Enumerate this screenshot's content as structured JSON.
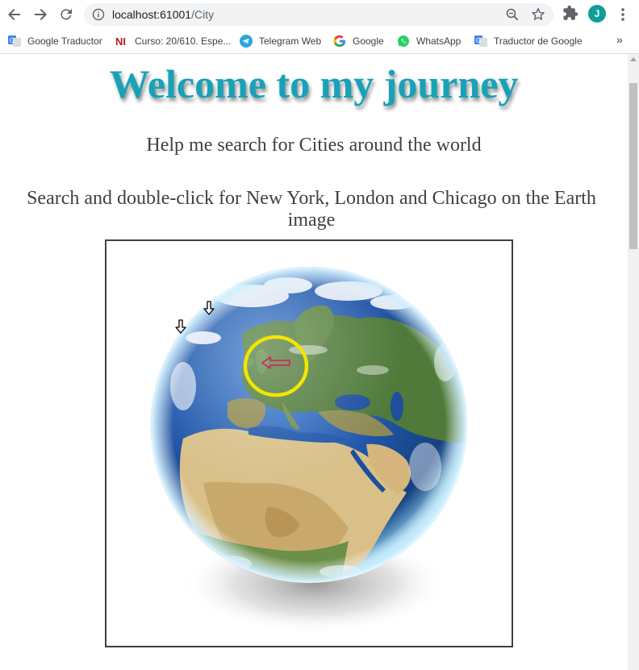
{
  "browser": {
    "url_host": "localhost:61001",
    "url_path": "/City",
    "profile_initial": "J",
    "bookmarks": [
      {
        "label": "Google Traductor",
        "icon": "google-translate-icon"
      },
      {
        "label": "Curso: 20/610. Espe...",
        "icon": "ni-logo-icon"
      },
      {
        "label": "Telegram Web",
        "icon": "telegram-icon"
      },
      {
        "label": "Google",
        "icon": "google-icon"
      },
      {
        "label": "WhatsApp",
        "icon": "whatsapp-icon"
      },
      {
        "label": "Traductor de Google",
        "icon": "google-translate-icon"
      }
    ],
    "overflow": "»"
  },
  "page": {
    "title": "Welcome to my journey",
    "subtitle": "Help me search for Cities around the world",
    "instruction": "Search and double-click for New York, London and Chicago on the Earth image"
  },
  "colors": {
    "title": "#17a2b8",
    "highlight_circle": "#f2e600",
    "target_arrow": "#d81b60"
  }
}
